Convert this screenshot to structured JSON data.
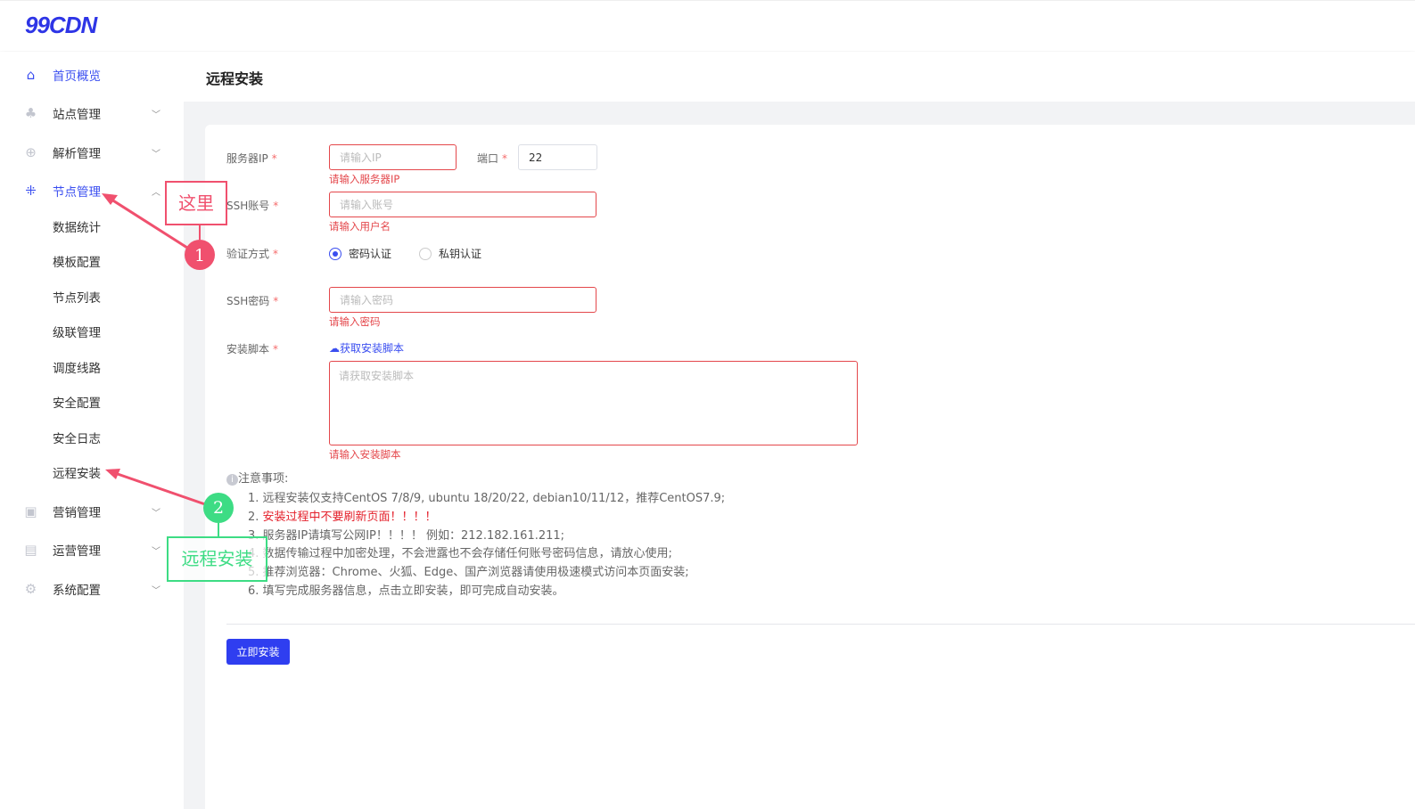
{
  "brand": {
    "logo": "99CDN",
    "accent": "#2f3ef0"
  },
  "sidebar": {
    "items": [
      {
        "label": "首页概览",
        "icon": "home-icon",
        "active": true
      },
      {
        "label": "站点管理",
        "icon": "sitemap-icon",
        "chevron": "chevron-down"
      },
      {
        "label": "解析管理",
        "icon": "globe-icon",
        "chevron": "chevron-down"
      },
      {
        "label": "节点管理",
        "icon": "nodes-icon",
        "chevron": "chevron-up",
        "active": true,
        "children": [
          "数据统计",
          "模板配置",
          "节点列表",
          "级联管理",
          "调度线路",
          "安全配置",
          "安全日志",
          "远程安装"
        ]
      },
      {
        "label": "营销管理",
        "icon": "presentation-icon",
        "chevron": "chevron-down"
      },
      {
        "label": "运营管理",
        "icon": "id-card-icon",
        "chevron": "chevron-down"
      },
      {
        "label": "系统配置",
        "icon": "gear-icon",
        "chevron": "chevron-down"
      }
    ]
  },
  "page": {
    "title": "远程安装"
  },
  "form": {
    "ip": {
      "label": "服务器IP",
      "placeholder": "请输入IP",
      "error": "请输入服务器IP"
    },
    "port": {
      "label": "端口",
      "value": "22"
    },
    "user": {
      "label": "SSH账号",
      "placeholder": "请输入账号",
      "error": "请输入用户名"
    },
    "auth": {
      "label": "验证方式",
      "options": [
        "密码认证",
        "私钥认证"
      ],
      "selected": "密码认证"
    },
    "password": {
      "label": "SSH密码",
      "placeholder": "请输入密码",
      "error": "请输入密码"
    },
    "script": {
      "label": "安装脚本",
      "fetch_link": "获取安装脚本",
      "placeholder": "请获取安装脚本",
      "error": "请输入安装脚本"
    },
    "required_mark": "*"
  },
  "notes": {
    "title": "注意事项:",
    "items": [
      "1. 远程安装仅支持CentOS 7/8/9, ubuntu 18/20/22, debian10/11/12，推荐CentOS7.9;",
      "安装过程中不要刷新页面！！！！",
      "3. 服务器IP请填写公网IP！！！！ 例如：212.182.161.211;",
      "4. 数据传输过程中加密处理，不会泄露也不会存储任何账号密码信息，请放心使用;",
      "5. 推荐浏览器：Chrome、火狐、Edge、国产浏览器请使用极速模式访问本页面安装;",
      "6. 填写完成服务器信息，点击立即安装，即可完成自动安装。"
    ],
    "item2_prefix": "2. "
  },
  "submit_label": "立即安装",
  "annotations": [
    {
      "number": "1",
      "text": "这里",
      "color": "#f0506e"
    },
    {
      "number": "2",
      "text": "远程安装",
      "color": "#3ddc84"
    }
  ]
}
